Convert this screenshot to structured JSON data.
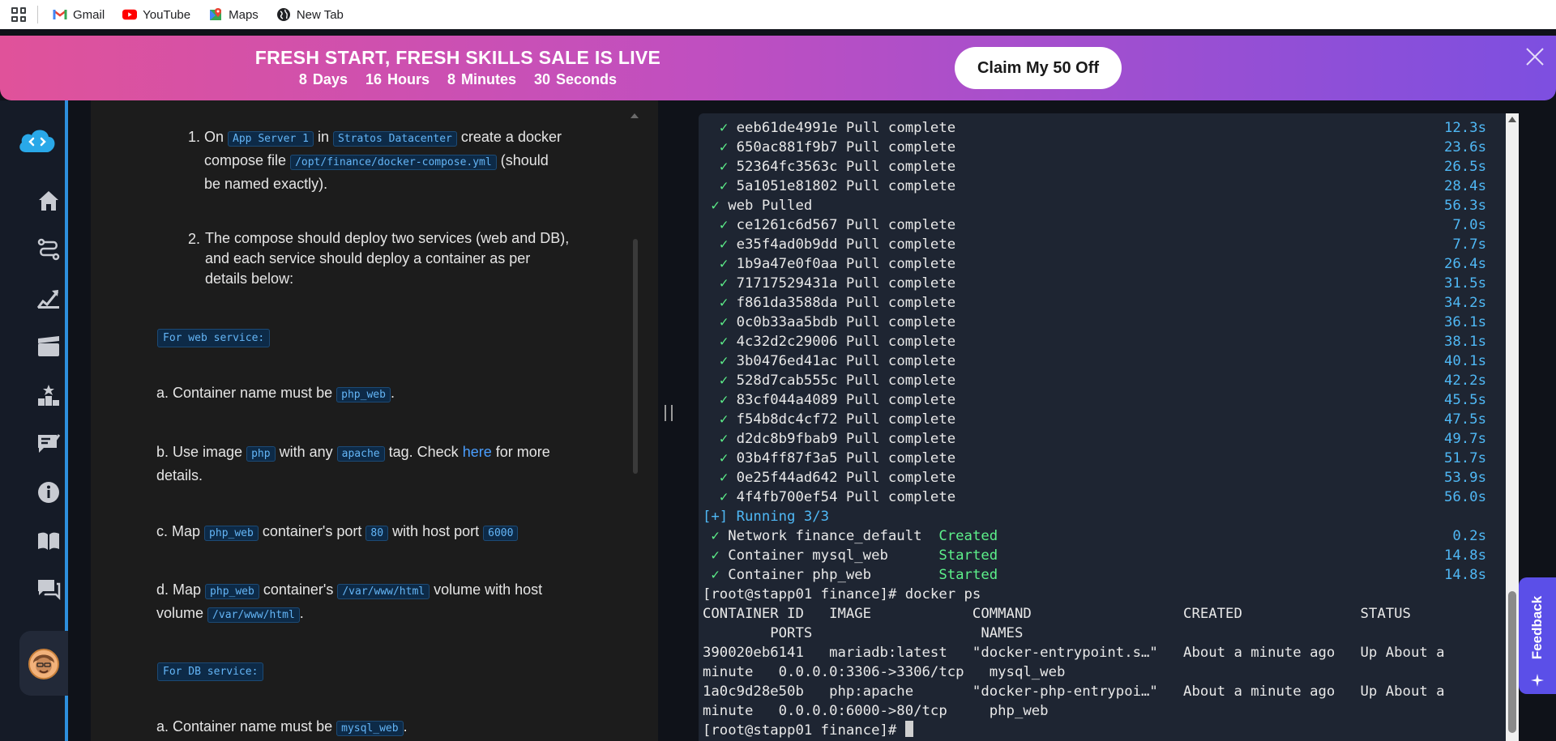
{
  "bookmarks": {
    "items": [
      {
        "label": "Gmail",
        "icon": "gmail-icon"
      },
      {
        "label": "YouTube",
        "icon": "youtube-icon"
      },
      {
        "label": "Maps",
        "icon": "maps-icon"
      },
      {
        "label": "New Tab",
        "icon": "globe-icon"
      }
    ]
  },
  "banner": {
    "title": "FRESH START, FRESH SKILLS SALE IS LIVE",
    "days": "8 Days",
    "hours": "16 Hours",
    "minutes": "8 Minutes",
    "seconds": "30 Seconds",
    "cta": "Claim My 50 Off"
  },
  "rail": {
    "icons": [
      "logo-cloud-icon",
      "home-icon",
      "path-icon",
      "chart-icon",
      "clapperboard-icon",
      "leaderboard-icon",
      "notes-icon",
      "info-icon",
      "book-icon",
      "chat-icon"
    ]
  },
  "task": {
    "step1": {
      "num": "1.",
      "on": "On",
      "code1": "App Server 1",
      "in": "in",
      "code2": "Stratos Datacenter",
      "t1": "create a docker",
      "t2": "compose file",
      "code3": "/opt/finance/docker-compose.yml",
      "t3": "(should",
      "t4": "be named exactly)."
    },
    "step2": {
      "num": "2.",
      "l1": "The compose should deploy two services (web and DB),",
      "l2": "and each service should deploy a container as per",
      "l3": "details below:"
    },
    "web_heading": "For web service:",
    "a": {
      "t1": "a. Container name must be",
      "code": "php_web",
      "t2": "."
    },
    "b": {
      "t1": "b. Use image",
      "code1": "php",
      "t2": "with any",
      "code2": "apache",
      "t3": "tag. Check",
      "link": "here",
      "t4": "for more",
      "t5": "details."
    },
    "c": {
      "t1": "c. Map",
      "code1": "php_web",
      "t2": "container's port",
      "code2": "80",
      "t3": "with host port",
      "code3": "6000"
    },
    "d": {
      "t1": "d. Map",
      "code1": "php_web",
      "t2": "container's",
      "code2": "/var/www/html",
      "t3": "volume with host",
      "t4": "volume",
      "code3": "/var/www/html",
      "t5": "."
    },
    "db_heading": "For DB service:",
    "db_a": {
      "t1": "a. Container name must be",
      "code": "mysql_web",
      "t2": "."
    }
  },
  "terminal": {
    "layers1": [
      {
        "id": "eeb61de4991e",
        "status": "Pull complete",
        "time": "12.3s"
      },
      {
        "id": "650ac881f9b7",
        "status": "Pull complete",
        "time": "23.6s"
      },
      {
        "id": "52364fc3563c",
        "status": "Pull complete",
        "time": "26.5s"
      },
      {
        "id": "5a1051e81802",
        "status": "Pull complete",
        "time": "28.4s"
      }
    ],
    "web_pulled": {
      "text": "web Pulled",
      "time": "56.3s"
    },
    "layers2": [
      {
        "id": "ce1261c6d567",
        "status": "Pull complete",
        "time": "7.0s"
      },
      {
        "id": "e35f4ad0b9dd",
        "status": "Pull complete",
        "time": "7.7s"
      },
      {
        "id": "1b9a47e0f0aa",
        "status": "Pull complete",
        "time": "26.4s"
      },
      {
        "id": "71717529431a",
        "status": "Pull complete",
        "time": "31.5s"
      },
      {
        "id": "f861da3588da",
        "status": "Pull complete",
        "time": "34.2s"
      },
      {
        "id": "0c0b33aa5bdb",
        "status": "Pull complete",
        "time": "36.1s"
      },
      {
        "id": "4c32d2c29006",
        "status": "Pull complete",
        "time": "38.1s"
      },
      {
        "id": "3b0476ed41ac",
        "status": "Pull complete",
        "time": "40.1s"
      },
      {
        "id": "528d7cab555c",
        "status": "Pull complete",
        "time": "42.2s"
      },
      {
        "id": "83cf044a4089",
        "status": "Pull complete",
        "time": "45.5s"
      },
      {
        "id": "f54b8dc4cf72",
        "status": "Pull complete",
        "time": "47.5s"
      },
      {
        "id": "d2dc8b9fbab9",
        "status": "Pull complete",
        "time": "49.7s"
      },
      {
        "id": "03b4ff87f3a5",
        "status": "Pull complete",
        "time": "51.7s"
      },
      {
        "id": "0e25f44ad642",
        "status": "Pull complete",
        "time": "53.9s"
      },
      {
        "id": "4f4fb700ef54",
        "status": "Pull complete",
        "time": "56.0s"
      }
    ],
    "running": "[+] Running 3/3",
    "resources": [
      {
        "name": "Network finance_default  ",
        "state": "Created",
        "time": "0.2s"
      },
      {
        "name": "Container mysql_web      ",
        "state": "Started",
        "time": "14.8s"
      },
      {
        "name": "Container php_web        ",
        "state": "Started",
        "time": "14.8s"
      }
    ],
    "prompt1": "[root@stapp01 finance]# docker ps",
    "ps_header1": "CONTAINER ID   IMAGE            COMMAND                  CREATED              STATUS",
    "ps_header2": "        PORTS                    NAMES",
    "row1a": "390020eb6141   mariadb:latest   \"docker-entrypoint.s…\"   About a minute ago   Up About a",
    "row1b": "minute   0.0.0.0:3306->3306/tcp   mysql_web",
    "row2a": "1a0c9d28e50b   php:apache       \"docker-php-entrypoi…\"   About a minute ago   Up About a",
    "row2b": "minute   0.0.0.0:6000->80/tcp     php_web",
    "prompt2": "[root@stapp01 finance]# "
  },
  "feedback": {
    "label": "Feedback"
  }
}
